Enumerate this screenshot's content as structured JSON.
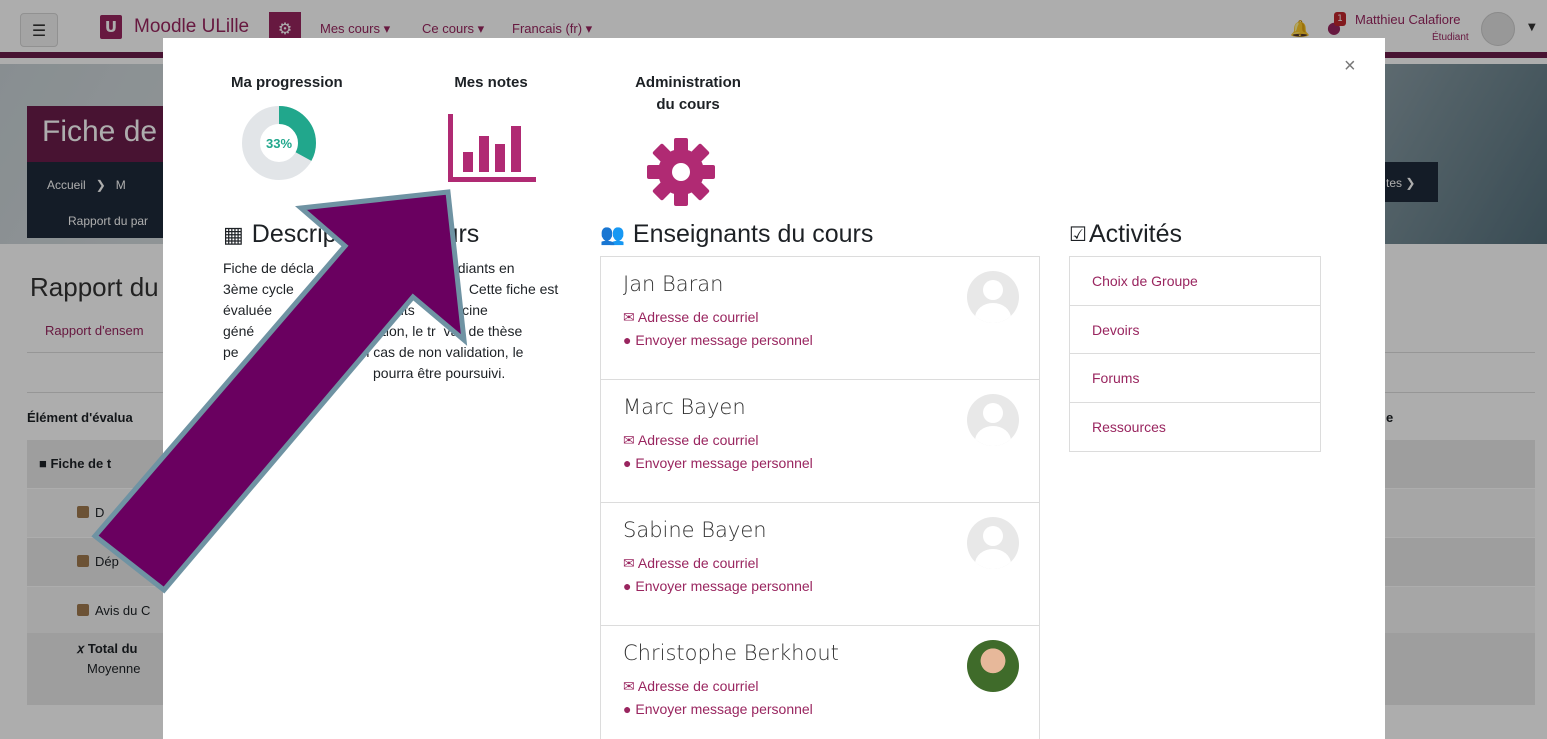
{
  "navbar": {
    "menu_icon": "hamburger-icon",
    "brand_logo": "U",
    "brand_name": "Moodle ULille",
    "menus": [
      "Mes cours",
      "Ce cours",
      "Francais (fr)"
    ],
    "user_name": "Matthieu Calafiore",
    "user_role": "Étudiant",
    "notification_count": "1"
  },
  "background": {
    "course_title": "Fiche de",
    "breadcrumb_home": "Accueil",
    "breadcrumb_m": "M",
    "breadcrumb_report": "Rapport du par",
    "breadcrumb_right": "tes",
    "report_title": "Rapport du",
    "report_link": "Rapport d'ensem",
    "grade_item_header": "Élément d'évalua",
    "grade_right_header": "e",
    "rows": [
      {
        "label": "Fiche de t",
        "icon": "folder-icon"
      },
      {
        "label": "D",
        "icon": "assignment-icon"
      },
      {
        "label": "Dép",
        "icon": "assignment-icon"
      },
      {
        "label": "Avis du C",
        "icon": "assignment-icon"
      },
      {
        "label": "Total du",
        "sub": "Moyenne",
        "icon": "sum-icon"
      }
    ]
  },
  "modal": {
    "close_label": "×",
    "tiles": {
      "progress_label": "Ma progression",
      "progress_value": "33%",
      "progress_fraction": 0.33,
      "grades_label": "Mes notes",
      "admin_label_line1": "Administration",
      "admin_label_line2": "du cours"
    },
    "description": {
      "heading": "Descrip",
      "heading_tail": "urs",
      "lines": [
        {
          "a": "Fiche de décla",
          "b": "tudiants en"
        },
        {
          "a": "3ème cycle",
          "b": "Cette fiche est"
        },
        {
          "a": "évaluée",
          "b": "nts",
          "c": "édecine"
        },
        {
          "a": "géné",
          "b": "ation, le tr",
          "c": "vail de thèse"
        },
        {
          "a": "pe",
          "b": "n cas de non validation, le"
        },
        {
          "a": "",
          "b": "pourra être poursuivi."
        }
      ]
    },
    "teachers": {
      "heading": "Enseignants du cours",
      "mail_label": "Adresse de courriel",
      "pm_label": "Envoyer message personnel",
      "list": [
        {
          "name": "Jan Baran",
          "avatar": "default"
        },
        {
          "name": "Marc Bayen",
          "avatar": "default"
        },
        {
          "name": "Sabine Bayen",
          "avatar": "default"
        },
        {
          "name": "Christophe Berkhout",
          "avatar": "photo"
        }
      ]
    },
    "activities": {
      "heading": "Activités",
      "items": [
        "Choix de Groupe",
        "Devoirs",
        "Forums",
        "Ressources"
      ]
    }
  },
  "colors": {
    "brand": "#99255f",
    "progress": "#21a78c",
    "arrow_fill": "#6a0060",
    "arrow_stroke": "#6f93a3"
  }
}
